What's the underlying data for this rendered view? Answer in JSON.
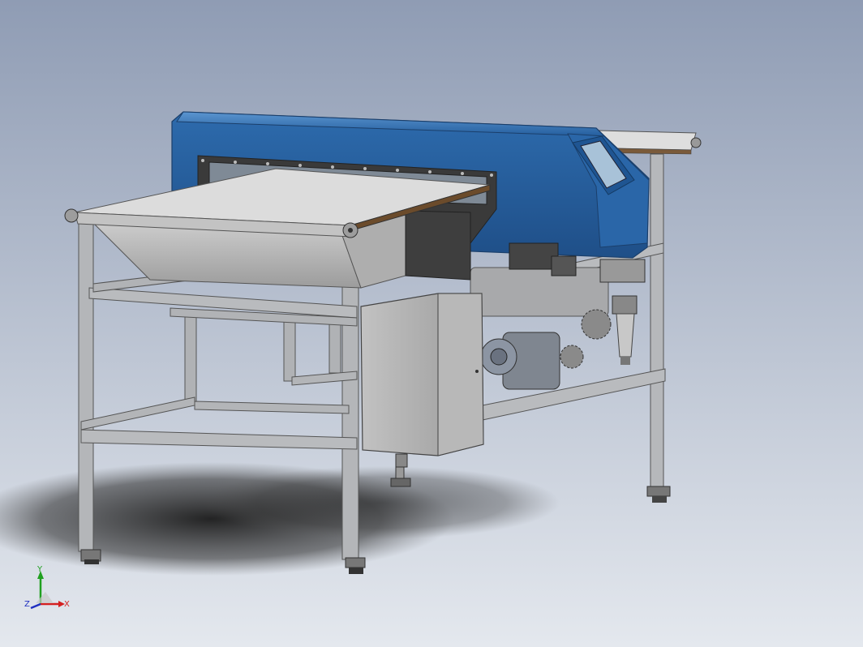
{
  "viewport": {
    "background_top": "#8f9cb4",
    "background_bottom": "#e4e8ee"
  },
  "model": {
    "components": [
      "metal-detector-head",
      "control-panel-display",
      "infeed-conveyor-belt",
      "outfeed-conveyor-belt",
      "reject-chute-hopper",
      "electrical-cabinet",
      "drive-motor",
      "gearbox",
      "sprockets",
      "air-filter-regulator",
      "stainless-frame",
      "leveling-feet"
    ],
    "colors": {
      "detector_blue": "#2f6fb3",
      "frame_steel": "#b4b6b9",
      "belt_light": "#dcdcdc",
      "cabinet_grey": "#c9c9c9"
    }
  },
  "triad": {
    "x_label": "X",
    "y_label": "Y",
    "z_label": "Z",
    "x_color": "#d42020",
    "y_color": "#20a020",
    "z_color": "#2030c0"
  }
}
